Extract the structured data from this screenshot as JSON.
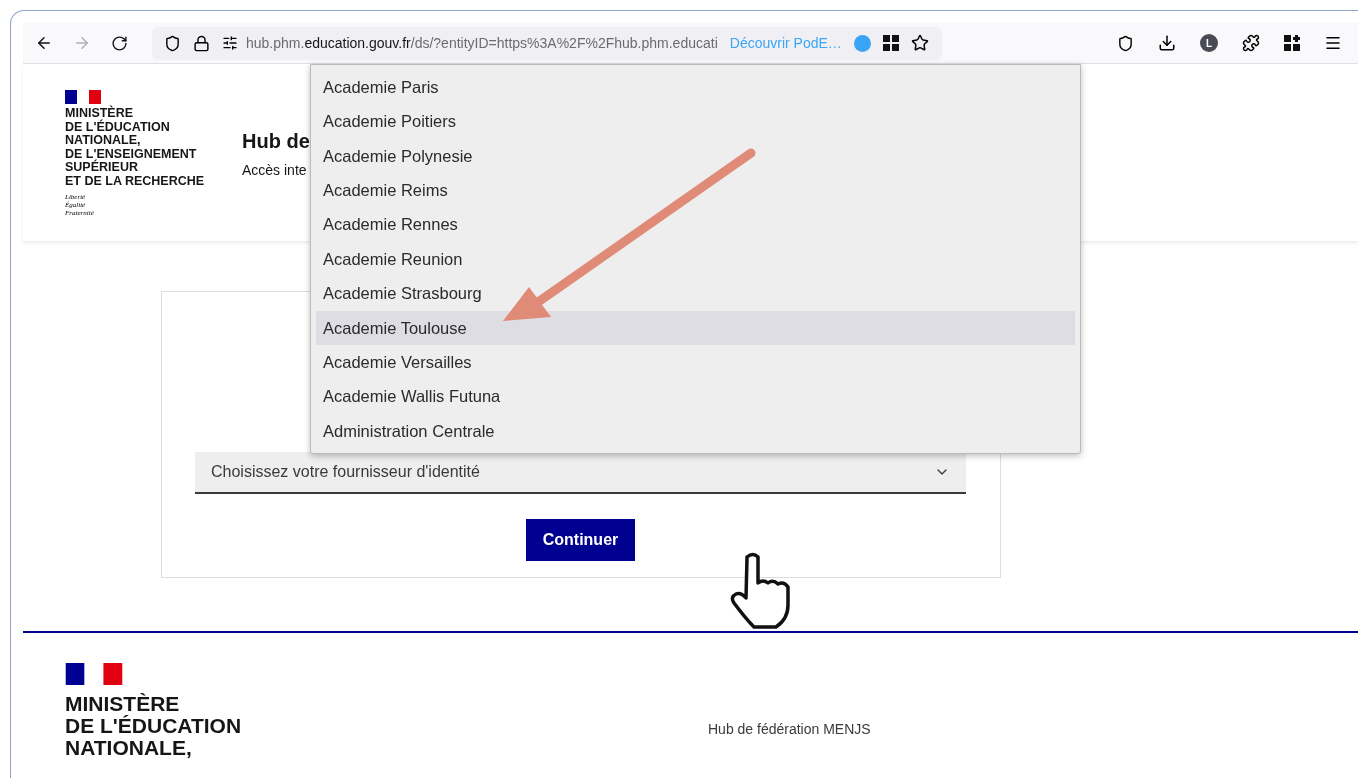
{
  "browser": {
    "url_host_prefix": "hub.phm.",
    "url_domain": "education.gouv.fr",
    "url_rest": "/ds/?entityID=https%3A%2F%2Fhub.phm.educati",
    "suggestion": "Découvrir PodE…",
    "profile_initial": "L"
  },
  "header": {
    "logo_lines": [
      "MINISTÈRE",
      "DE L'ÉDUCATION",
      "NATIONALE,",
      "DE L'ENSEIGNEMENT",
      "SUPÉRIEUR",
      "ET DE LA RECHERCHE"
    ],
    "motto": [
      "Liberté",
      "Égalité",
      "Fraternité"
    ],
    "title": "Hub de",
    "subtitle": "Accès inte"
  },
  "dropdown": {
    "options": [
      {
        "label": "Academie Paris",
        "selected": false
      },
      {
        "label": "Academie Poitiers",
        "selected": false
      },
      {
        "label": "Academie Polynesie",
        "selected": false
      },
      {
        "label": "Academie Reims",
        "selected": false
      },
      {
        "label": "Academie Rennes",
        "selected": false
      },
      {
        "label": "Academie Reunion",
        "selected": false
      },
      {
        "label": "Academie Strasbourg",
        "selected": false
      },
      {
        "label": "Academie Toulouse",
        "selected": true
      },
      {
        "label": "Academie Versailles",
        "selected": false
      },
      {
        "label": "Academie Wallis Futuna",
        "selected": false
      },
      {
        "label": "Administration Centrale",
        "selected": false
      }
    ]
  },
  "form": {
    "select_placeholder": "Choisissez votre fournisseur d'identité",
    "button": "Continuer"
  },
  "footer": {
    "logo_lines": [
      "MINISTÈRE",
      "DE L'ÉDUCATION",
      "NATIONALE,"
    ],
    "site_name": "Hub de fédération MENJS"
  }
}
